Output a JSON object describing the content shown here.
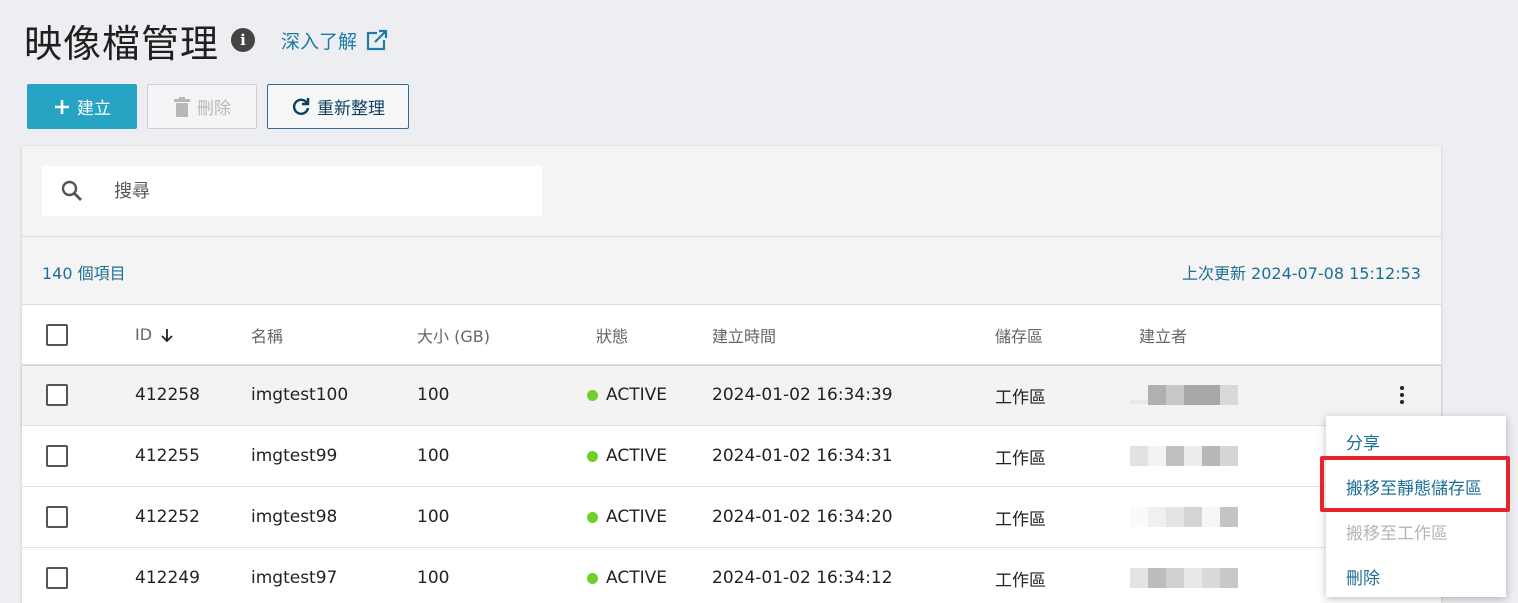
{
  "header": {
    "title": "映像檔管理",
    "info_icon": "i",
    "learn_more": "深入了解"
  },
  "toolbar": {
    "create_label": "建立",
    "delete_label": "刪除",
    "refresh_label": "重新整理"
  },
  "search": {
    "placeholder": "搜尋"
  },
  "summary": {
    "count": "140 個項目",
    "last_updated": "上次更新 2024-07-08 15:12:53"
  },
  "table": {
    "columns": [
      "ID",
      "名稱",
      "大小 (GB)",
      "狀態",
      "建立時間",
      "儲存區",
      "建立者"
    ],
    "rows": [
      {
        "id": "412258",
        "name": "imgtest100",
        "size": "100",
        "status": "ACTIVE",
        "created": "2024-01-02 16:34:39",
        "storage": "工作區"
      },
      {
        "id": "412255",
        "name": "imgtest99",
        "size": "100",
        "status": "ACTIVE",
        "created": "2024-01-02 16:34:31",
        "storage": "工作區"
      },
      {
        "id": "412252",
        "name": "imgtest98",
        "size": "100",
        "status": "ACTIVE",
        "created": "2024-01-02 16:34:20",
        "storage": "工作區"
      },
      {
        "id": "412249",
        "name": "imgtest97",
        "size": "100",
        "status": "ACTIVE",
        "created": "2024-01-02 16:34:12",
        "storage": "工作區"
      }
    ]
  },
  "context_menu": {
    "items": [
      {
        "label": "分享",
        "enabled": true
      },
      {
        "label": "搬移至靜態儲存區",
        "enabled": true
      },
      {
        "label": "搬移至工作區",
        "enabled": false
      },
      {
        "label": "刪除",
        "enabled": true
      }
    ]
  },
  "colors": {
    "primary": "#27a3c4",
    "link": "#1e6f96",
    "active_status": "#6fcf2c",
    "highlight": "#e4262c"
  }
}
